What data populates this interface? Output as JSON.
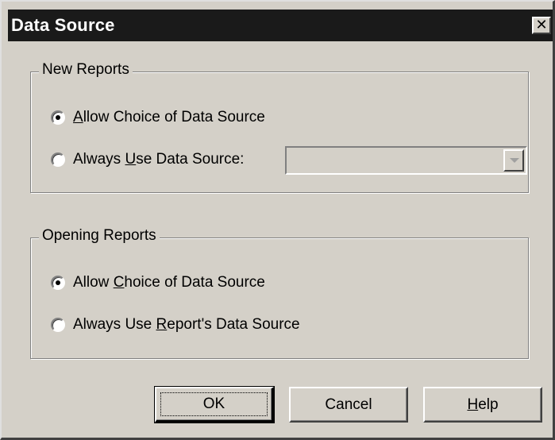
{
  "window": {
    "title": "Data Source",
    "close_glyph": "✕"
  },
  "new_reports": {
    "title": "New Reports",
    "allow_choice": {
      "label_pre": "",
      "label_mnemonic": "A",
      "label_post": "llow Choice of Data Source",
      "checked": true
    },
    "always_use": {
      "label_pre": "Always ",
      "label_mnemonic": "U",
      "label_post": "se Data Source:",
      "checked": false
    },
    "data_source_value": ""
  },
  "opening_reports": {
    "title": "Opening Reports",
    "allow_choice": {
      "label_pre": "Allow ",
      "label_mnemonic": "C",
      "label_post": "hoice of Data Source",
      "checked": true
    },
    "always_use_reports": {
      "label_pre": "Always Use ",
      "label_mnemonic": "R",
      "label_post": "eport's Data Source",
      "checked": false
    }
  },
  "buttons": {
    "ok": "OK",
    "cancel": "Cancel",
    "help_pre": "",
    "help_mnemonic": "H",
    "help_post": "elp"
  }
}
